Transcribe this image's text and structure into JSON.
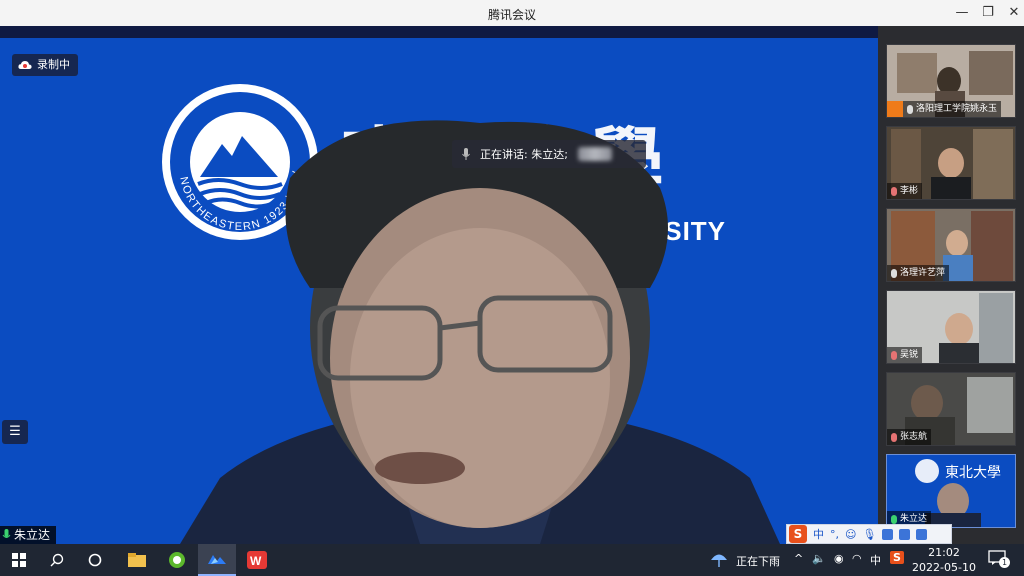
{
  "window": {
    "title": "腾讯会议"
  },
  "main": {
    "recording_label": "录制中",
    "speaking_label": "正在讲话: 朱立达;",
    "current_speaker": "朱立达",
    "banner_university_text": "UNIVERSITY"
  },
  "participants": [
    {
      "name": "洛阳理工学院姚永玉"
    },
    {
      "name": "李彬"
    },
    {
      "name": "洛理许艺萍"
    },
    {
      "name": "吴锐"
    },
    {
      "name": "张志航"
    },
    {
      "name": "朱立达"
    }
  ],
  "ime": {
    "mode": "中"
  },
  "taskbar": {
    "weather": "正在下雨",
    "tray_lang": "中",
    "time": "21:02",
    "date": "2022-05-10",
    "notification_count": "1"
  },
  "colors": {
    "banner_blue": "#0b4cc1",
    "taskbar": "#1f2633",
    "mic_active": "#3bd16f"
  }
}
